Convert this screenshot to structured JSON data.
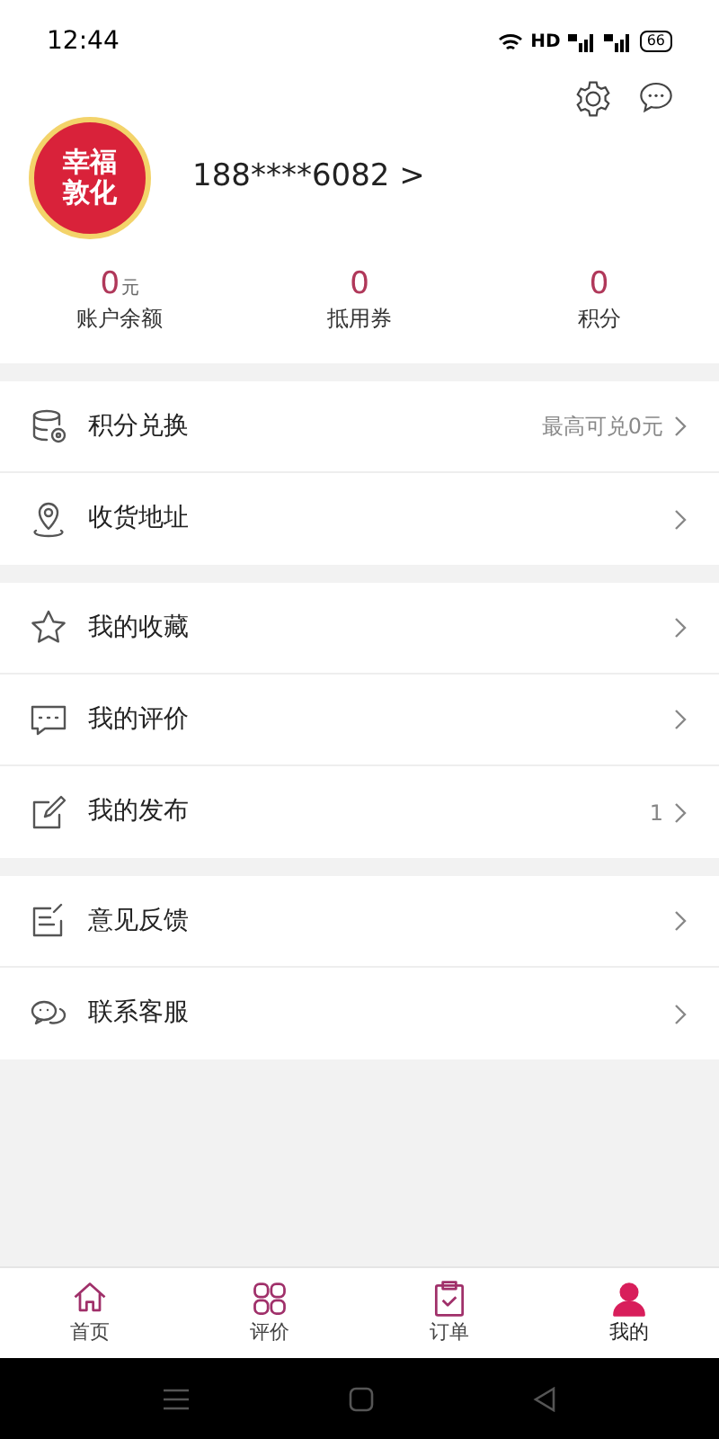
{
  "status_bar": {
    "time": "12:44",
    "network": "HD",
    "battery": "66"
  },
  "profile": {
    "logo_lines": [
      "幸福",
      "敦化"
    ],
    "phone": "188****6082 >"
  },
  "stats": [
    {
      "value": "0",
      "unit": "元",
      "label": "账户余额"
    },
    {
      "value": "0",
      "label": "抵用券"
    },
    {
      "value": "0",
      "label": "积分"
    }
  ],
  "sections": [
    [
      {
        "label": "积分兑换",
        "detail": "最高可兑0元"
      },
      {
        "label": "收货地址"
      }
    ],
    [
      {
        "label": "我的收藏"
      },
      {
        "label": "我的评价"
      },
      {
        "label": "我的发布",
        "detail": "1"
      }
    ],
    [
      {
        "label": "意见反馈"
      },
      {
        "label": "联系客服"
      }
    ]
  ],
  "tab_bar": [
    {
      "label": "首页",
      "selected": false
    },
    {
      "label": "评价",
      "selected": false
    },
    {
      "label": "订单",
      "selected": false
    },
    {
      "label": "我的",
      "selected": true
    }
  ]
}
